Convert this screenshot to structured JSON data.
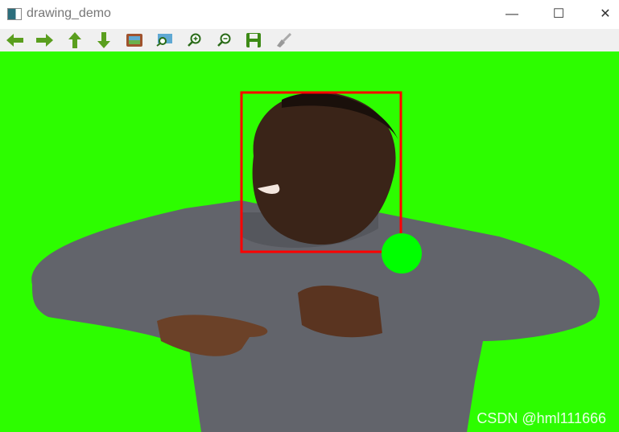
{
  "window": {
    "title": "drawing_demo",
    "minimize": "—",
    "maximize": "☐",
    "close": "✕"
  },
  "toolbar": [
    "arrow-left",
    "arrow-right",
    "arrow-up",
    "arrow-down",
    "image",
    "zoom-area",
    "zoom-in",
    "zoom-out",
    "save",
    "clear"
  ],
  "image": {
    "watermark": "CSDN @hml111666",
    "background_color": "#2dfd00",
    "rect_color": "#ff0000",
    "circle_color": "#00ff00"
  }
}
